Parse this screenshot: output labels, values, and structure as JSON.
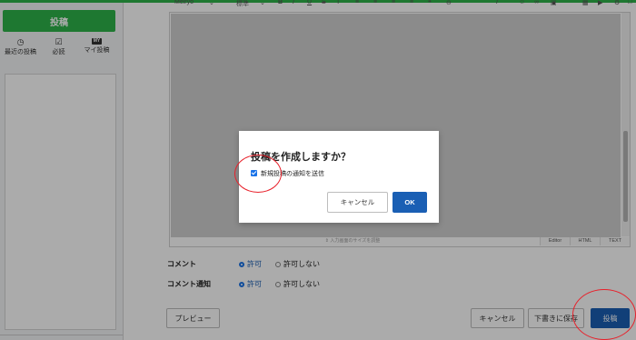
{
  "sidebar": {
    "post_button": "投稿",
    "tabs": [
      {
        "label": "最近の投稿",
        "icon": "clock-icon"
      },
      {
        "label": "必読",
        "icon": "checkbox-icon"
      },
      {
        "label": "マイ投稿",
        "icon": "my-post-icon",
        "icon_text": "MY"
      }
    ]
  },
  "toolbar": {
    "font": "Meiryo",
    "font_style": "標準",
    "bold": "B",
    "italic": "I",
    "underline": "U",
    "strike": "S",
    "color": "T"
  },
  "editor": {
    "resize_hint": "入力画面のサイズを調整",
    "modes": [
      "Editor",
      "HTML",
      "TEXT"
    ]
  },
  "settings": {
    "comment": {
      "label": "コメント",
      "options": [
        "許可",
        "許可しない"
      ],
      "selected": "許可"
    },
    "comment_notify": {
      "label": "コメント通知",
      "options": [
        "許可",
        "許可しない"
      ],
      "selected": "許可"
    }
  },
  "footer": {
    "preview": "プレビュー",
    "cancel": "キャンセル",
    "save_draft": "下書きに保存",
    "post": "投稿"
  },
  "dialog": {
    "title": "投稿を作成しますか？",
    "checkbox_label": "新規投稿の通知を送信",
    "checkbox_checked": true,
    "cancel": "キャンセル",
    "ok": "OK"
  },
  "colors": {
    "brand_green": "#2db34a",
    "primary_blue": "#1a5fb4",
    "annotation_red": "#e8202a"
  }
}
